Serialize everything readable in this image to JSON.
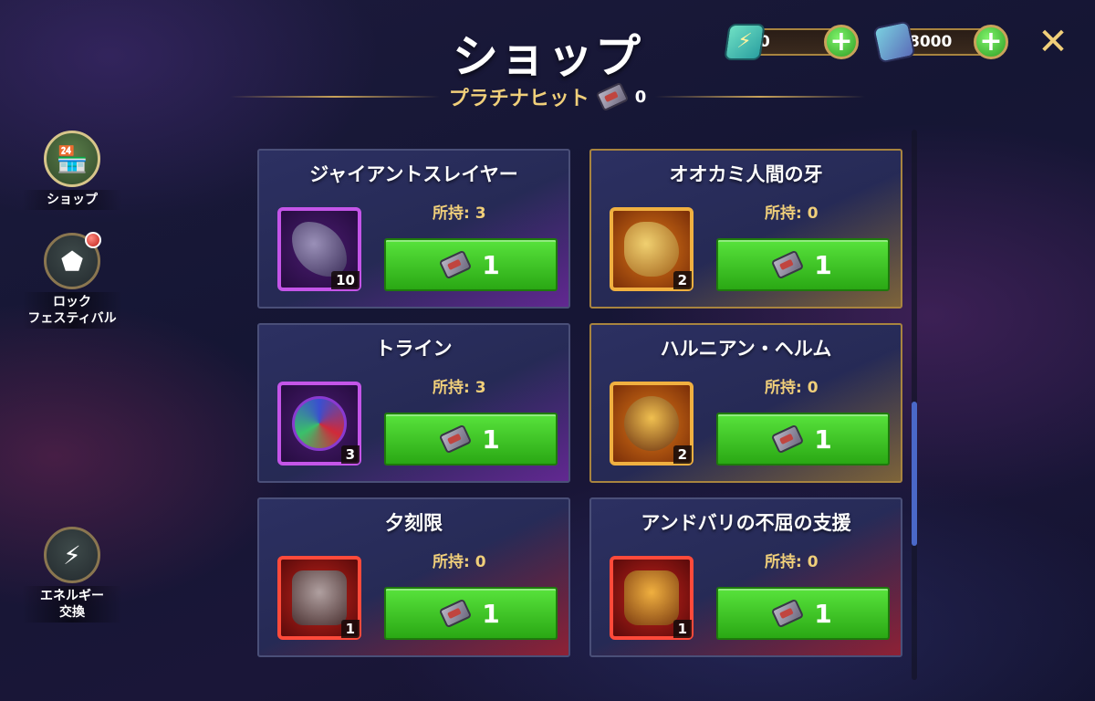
{
  "header": {
    "title": "ショップ",
    "subtitle": "プラチナヒット",
    "ticket_count": "0"
  },
  "currencies": {
    "energy": {
      "value": "0",
      "icon": "energy-icon"
    },
    "gems": {
      "value": "8000",
      "icon": "gem-icon"
    }
  },
  "sidebar": {
    "items": [
      {
        "label": "ショップ",
        "icon": "shop-icon",
        "active": true
      },
      {
        "label": "ロック\nフェスティバル",
        "icon": "star-badge-icon",
        "notification": true
      },
      {
        "label": "エネルギー\n交換",
        "icon": "energy-exchange-icon"
      }
    ]
  },
  "owned_prefix": "所持: ",
  "items": [
    {
      "name": "ジャイアントスレイヤー",
      "owned": "所持: 3",
      "qty": "10",
      "price": "1",
      "rarity": "purple"
    },
    {
      "name": "オオカミ人間の牙",
      "owned": "所持: 0",
      "qty": "2",
      "price": "1",
      "rarity": "gold"
    },
    {
      "name": "トライン",
      "owned": "所持: 3",
      "qty": "3",
      "price": "1",
      "rarity": "purple"
    },
    {
      "name": "ハルニアン・ヘルム",
      "owned": "所持: 0",
      "qty": "2",
      "price": "1",
      "rarity": "gold"
    },
    {
      "name": "夕刻限",
      "owned": "所持: 0",
      "qty": "1",
      "price": "1",
      "rarity": "red"
    },
    {
      "name": "アンドバリの不屈の支援",
      "owned": "所持: 0",
      "qty": "1",
      "price": "1",
      "rarity": "red"
    }
  ],
  "colors": {
    "accent_gold": "#f0cf7a",
    "buy_green": "#3cc626",
    "purple_rarity": "#c455e8",
    "gold_rarity": "#f0b040",
    "red_rarity": "#ff4a3a"
  }
}
